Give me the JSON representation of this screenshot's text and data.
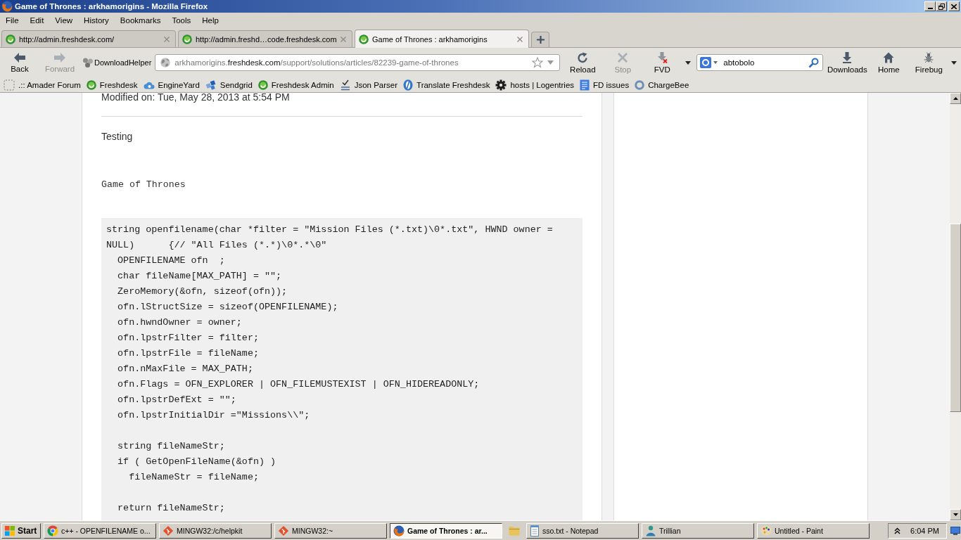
{
  "window": {
    "title": "Game of Thrones : arkhamorigins - Mozilla Firefox"
  },
  "menu_bar": [
    "File",
    "Edit",
    "View",
    "History",
    "Bookmarks",
    "Tools",
    "Help"
  ],
  "tabs": [
    {
      "label": "http://admin.freshdesk.com/",
      "selected": false
    },
    {
      "label": "http://admin.freshd…code.freshdesk.com",
      "selected": false
    },
    {
      "label": "Game of Thrones : arkhamorigins",
      "selected": true
    }
  ],
  "nav_toolbar": {
    "history_buttons": [
      {
        "label": "Back",
        "disabled": false
      },
      {
        "label": "Forward",
        "disabled": true
      }
    ],
    "download_helper": "DownloadHelper",
    "address_bar": {
      "subdomain": "arkhamorigins.",
      "domain": "freshdesk.com",
      "path": "/support/solutions/articles/82239-game-of-thrones"
    },
    "page_buttons": [
      {
        "label": "Reload",
        "disabled": false
      },
      {
        "label": "Stop",
        "disabled": true
      },
      {
        "label": "FVD",
        "disabled": false
      }
    ],
    "search": {
      "value": "abtobolo"
    },
    "tool_buttons": [
      "Downloads",
      "Home",
      "Firebug"
    ]
  },
  "bookmarks": [
    ".:: Amader Forum",
    "Freshdesk",
    "EngineYard",
    "Sendgrid",
    "Freshdesk Admin",
    "Json Parser",
    "Translate Freshdesk",
    "hosts | Logentries",
    "FD issues",
    "ChargeBee"
  ],
  "article": {
    "modified": "Modified on: Tue, May 28, 2013 at 5:54 PM",
    "body": "Testing",
    "heading": "Game of Thrones",
    "code_blocks": [
      [
        "string openfilename(char *filter = \"Mission Files (*.txt)\\0*.txt\", HWND owner =",
        "NULL)      {// \"All Files (*.*)\\0*.*\\0\"",
        "  OPENFILENAME ofn  ;",
        "  char fileName[MAX_PATH] = \"\";",
        "  ZeroMemory(&ofn, sizeof(ofn));",
        "  ofn.lStructSize = sizeof(OPENFILENAME);",
        "  ofn.hwndOwner = owner;",
        "  ofn.lpstrFilter = filter;",
        "  ofn.lpstrFile = fileName;",
        "  ofn.nMaxFile = MAX_PATH;",
        "  ofn.Flags = OFN_EXPLORER | OFN_FILEMUSTEXIST | OFN_HIDEREADONLY;",
        "  ofn.lpstrDefExt = \"\";",
        "  ofn.lpstrInitialDir =\"Missions\\\\\";"
      ],
      [
        "  string fileNameStr;",
        "  if ( GetOpenFileName(&ofn) )",
        "    fileNameStr = fileName;"
      ],
      [
        "  return fileNameStr;"
      ]
    ]
  },
  "taskbar": {
    "start": "Start",
    "items": [
      {
        "kind": "window",
        "label": "c++ - OPENFILENAME o...",
        "selected": false
      },
      {
        "kind": "window",
        "label": "MINGW32:/c/helpkit",
        "selected": false
      },
      {
        "kind": "window",
        "label": "MINGW32:~",
        "selected": false
      },
      {
        "kind": "window",
        "label": "Game of Thrones : ar...",
        "selected": true
      },
      {
        "kind": "icon",
        "selected": false
      },
      {
        "kind": "window",
        "label": "sso.txt - Notepad",
        "selected": false
      },
      {
        "kind": "window",
        "label": "Trillian",
        "selected": false
      },
      {
        "kind": "window",
        "label": "Untitled - Paint",
        "selected": false
      }
    ],
    "clock": "6:04 PM"
  }
}
